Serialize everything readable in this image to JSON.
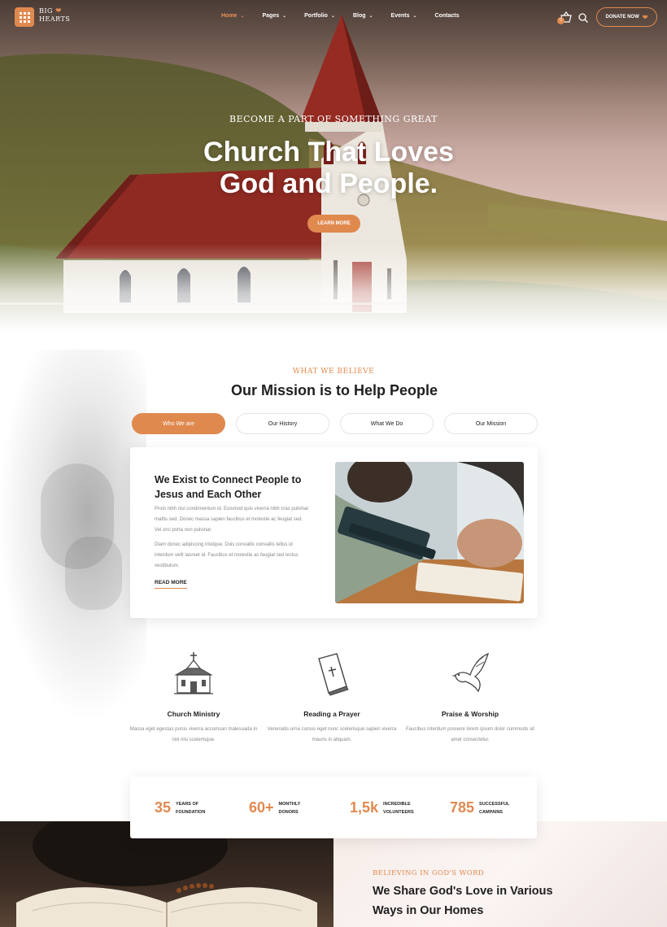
{
  "brand": {
    "name_line1": "BIG",
    "name_line2": "HEARTS"
  },
  "nav": {
    "items": [
      {
        "label": "Home",
        "active": true,
        "dropdown": true
      },
      {
        "label": "Pages",
        "active": false,
        "dropdown": true
      },
      {
        "label": "Portfolio",
        "active": false,
        "dropdown": true
      },
      {
        "label": "Blog",
        "active": false,
        "dropdown": true
      },
      {
        "label": "Events",
        "active": false,
        "dropdown": true
      },
      {
        "label": "Contacts",
        "active": false,
        "dropdown": false
      }
    ],
    "cart_count": "0",
    "donate_label": "DONATE NOW"
  },
  "hero": {
    "kicker": "BECOME A PART OF SOMETHING GREAT",
    "title_line1": "Church That Loves",
    "title_line2": "God and People.",
    "button_label": "LEARN MORE"
  },
  "mission": {
    "kicker": "WHAT WE BELIEVE",
    "title": "Our Mission is to Help People",
    "tabs": [
      "Who We are",
      "Our History",
      "What We Do",
      "Our Mission"
    ],
    "active_tab": 0,
    "card": {
      "title": "We Exist to Connect People to Jesus and Each Other",
      "paragraph1": "Proin nibh nisl condimentum id. Euismod quis viverra nibh cras pulvinar mattis sed. Donec massa sapien faucibus et molestie ac feugiat sed. Vel orci porta non pulvinar.",
      "paragraph2": "Diam donec adipiscing tristique. Duis convallis convallis tellus id interdum velit laoreet id. Faucibus et molestie ac feugiat sed lectus vestibulum.",
      "read_more": "READ MORE"
    }
  },
  "features": [
    {
      "icon": "church-icon",
      "title": "Church Ministry",
      "text": "Massa eget egestas purus viverra accumsan malesuada in nisl nisi scelerisque."
    },
    {
      "icon": "bible-icon",
      "title": "Reading a Prayer",
      "text": "Venenatis urna cursus eget nunc scelerisque sapien viverra mauris in aliquam."
    },
    {
      "icon": "dove-icon",
      "title": "Praise & Worship",
      "text": "Faucibus interdum posuere lorem ipsum dolor commodo sit amet consectetur."
    }
  ],
  "stats": [
    {
      "value": "35",
      "label_line1": "YEARS OF",
      "label_line2": "FOUNDATION"
    },
    {
      "value": "60+",
      "label_line1": "MONTHLY",
      "label_line2": "DONORS"
    },
    {
      "value": "1,5k",
      "label_line1": "INCREDIBLE",
      "label_line2": "VOLUNTEERS"
    },
    {
      "value": "785",
      "label_line1": "SUCCESSFUL",
      "label_line2": "CAMPAINS"
    }
  ],
  "bottom": {
    "kicker": "BELIEVING IN GOD'S WORD",
    "title": "We Share God's Love in Various Ways in Our Homes"
  },
  "colors": {
    "accent": "#e0894f",
    "text": "#1f1f1f",
    "muted": "#888888"
  }
}
